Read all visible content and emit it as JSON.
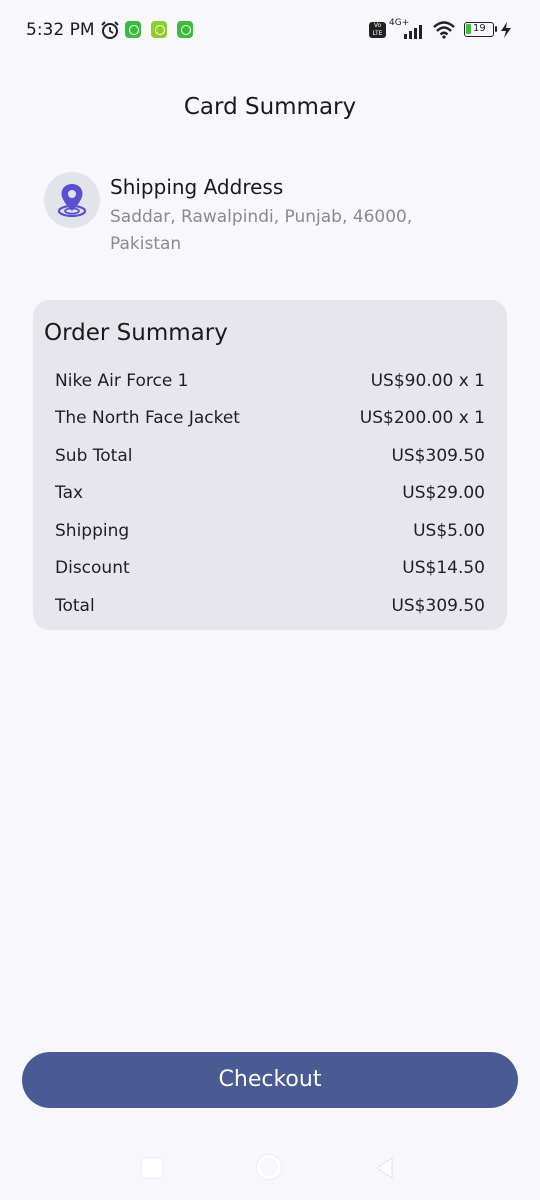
{
  "status_bar": {
    "time": "5:32 PM",
    "network": "4G+",
    "volte": "Vo LTE",
    "battery": "19",
    "icons": [
      "alarm-icon",
      "app-badge-icon",
      "app-badge-icon",
      "app-badge-icon",
      "signal-icon",
      "wifi-icon",
      "battery-icon",
      "charging-icon"
    ]
  },
  "header": {
    "title": "Card Summary"
  },
  "shipping": {
    "icon": "location-pin-icon",
    "title": "Shipping Address",
    "address": "Saddar, Rawalpindi, Punjab, 46000, Pakistan"
  },
  "order_summary": {
    "title": "Order Summary",
    "rows": [
      {
        "label": "Nike Air Force 1",
        "value": "US$90.00 x 1"
      },
      {
        "label": "The North Face Jacket",
        "value": "US$200.00 x 1"
      },
      {
        "label": "Sub Total",
        "value": "US$309.50"
      },
      {
        "label": "Tax",
        "value": "US$29.00"
      },
      {
        "label": "Shipping",
        "value": "US$5.00"
      },
      {
        "label": "Discount",
        "value": "US$14.50"
      },
      {
        "label": "Total",
        "value": "US$309.50"
      }
    ]
  },
  "checkout": {
    "label": "Checkout"
  },
  "colors": {
    "background": "#f7f7fc",
    "card": "#e7e6ed",
    "accent_button": "#4a5a93",
    "pin": "#5a4fcf"
  }
}
